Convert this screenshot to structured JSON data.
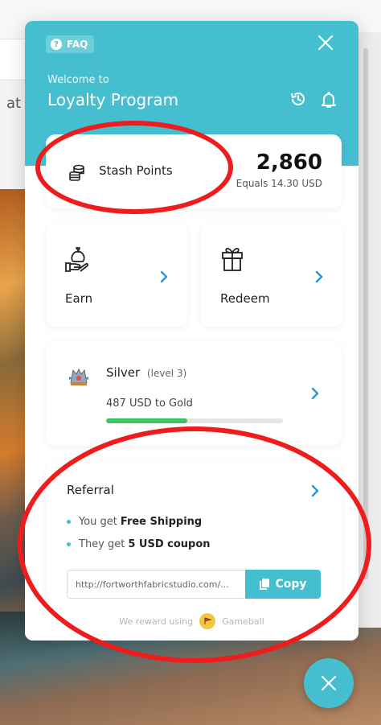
{
  "background": {
    "partial_text": "at"
  },
  "header": {
    "faq_label": "FAQ",
    "welcome": "Welcome to",
    "program": "Loyalty Program"
  },
  "stash": {
    "label": "Stash Points",
    "points": "2,860",
    "equals": "Equals 14.30 USD"
  },
  "earn": {
    "label": "Earn"
  },
  "redeem": {
    "label": "Redeem"
  },
  "tier": {
    "name": "Silver",
    "level": "(level 3)",
    "to_next": "487 USD to Gold",
    "progress": 0.46
  },
  "referral": {
    "title": "Referral",
    "you_get_prefix": "You get",
    "you_get_value": "Free Shipping",
    "they_get_prefix": "They get",
    "they_get_value": "5 USD coupon",
    "link": "http://fortworthfabricstudio.com/...",
    "copy_label": "Copy"
  },
  "footer": {
    "text": "We reward using",
    "brand": "Gameball"
  },
  "colors": {
    "accent": "#45bfd0",
    "progress": "#3cc463",
    "annotation": "#ee1c1c"
  },
  "icons": [
    "faq-icon",
    "close-icon",
    "history-icon",
    "bell-icon",
    "coins-icon",
    "money-bag-hand-icon",
    "gift-icon",
    "chevron-right-icon",
    "silver-badge-icon",
    "copy-icon",
    "gameball-logo-icon"
  ]
}
